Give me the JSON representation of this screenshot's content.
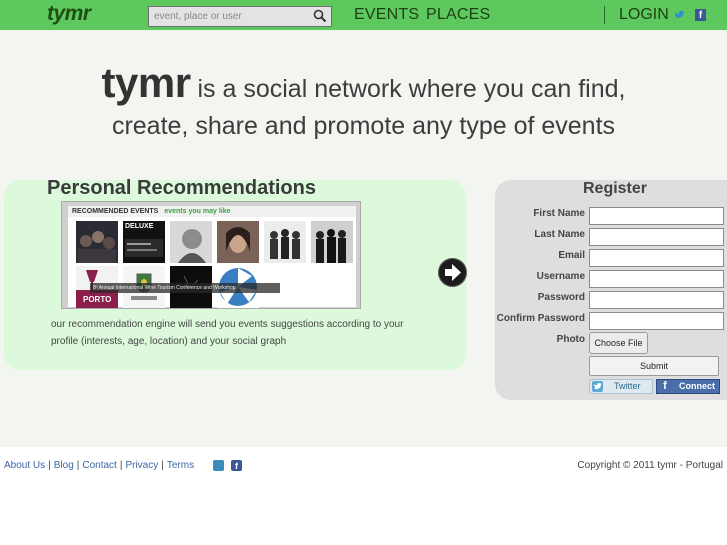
{
  "header": {
    "logo": "tymr",
    "search_placeholder": "event, place or user",
    "nav_events": "EVENTS",
    "nav_places": "PLACES",
    "login": "LOGIN",
    "icons": [
      "search-icon",
      "twitter-icon",
      "facebook-icon"
    ]
  },
  "hero": {
    "brand": "tymr",
    "line1": " is a social network where you can find,",
    "line2": "create, share and promote any type of events"
  },
  "recommendations": {
    "title": "Personal Recommendations",
    "screenshot_header": "RECOMMENDED EVENTS",
    "screenshot_subheader": "events you may like",
    "thumb_labels": [
      "DELUXE",
      "PORTO"
    ],
    "thumb_caption": "8º Annual International Wine Tourism Conference and Workshop",
    "description": "our recommendation engine will send you events suggestions according to your profile (interests, age, location) and your social graph"
  },
  "register": {
    "title": "Register",
    "fields": [
      {
        "label": "First Name",
        "value": ""
      },
      {
        "label": "Last Name",
        "value": ""
      },
      {
        "label": "Email",
        "value": ""
      },
      {
        "label": "Username",
        "value": ""
      },
      {
        "label": "Password",
        "value": ""
      },
      {
        "label": "Confirm Password",
        "value": ""
      }
    ],
    "photo_label": "Photo",
    "choose_file": "Choose File",
    "submit": "Submit",
    "twitter": "Twitter",
    "facebook": "Connect"
  },
  "footer": {
    "links": [
      "About Us",
      "Blog",
      "Contact",
      "Privacy",
      "Terms"
    ],
    "copyright": "Copyright © 2011 tymr - Portugal"
  },
  "colors": {
    "topbar": "#5dc85e",
    "rec_panel": "#dcfadb",
    "reg_panel": "#dedede",
    "link": "#3c66a8"
  }
}
